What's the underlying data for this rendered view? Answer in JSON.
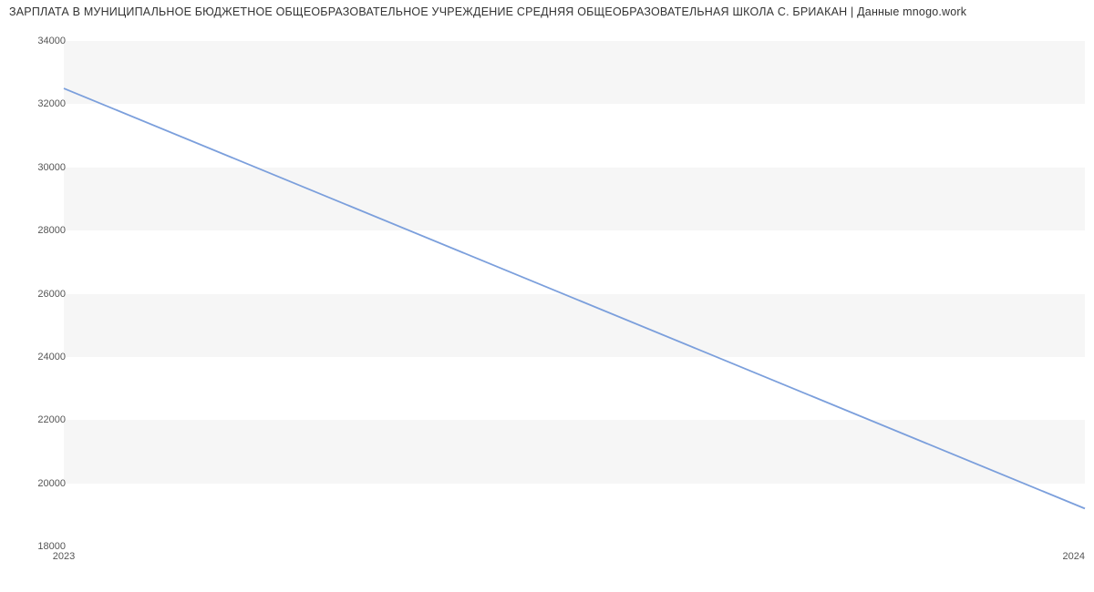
{
  "chart_data": {
    "type": "line",
    "title": "ЗАРПЛАТА В МУНИЦИПАЛЬНОЕ БЮДЖЕТНОЕ ОБЩЕОБРАЗОВАТЕЛЬНОЕ УЧРЕЖДЕНИЕ СРЕДНЯЯ ОБЩЕОБРАЗОВАТЕЛЬНАЯ ШКОЛА С. БРИАКАН | Данные mnogo.work",
    "x": [
      2023,
      2024
    ],
    "values": [
      32500,
      19200
    ],
    "xlabel": "",
    "ylabel": "",
    "ylim": [
      18000,
      34000
    ],
    "y_ticks": [
      18000,
      20000,
      22000,
      24000,
      26000,
      28000,
      30000,
      32000,
      34000
    ],
    "x_ticks": [
      2023,
      2024
    ],
    "series_color": "#7b9fdc"
  }
}
